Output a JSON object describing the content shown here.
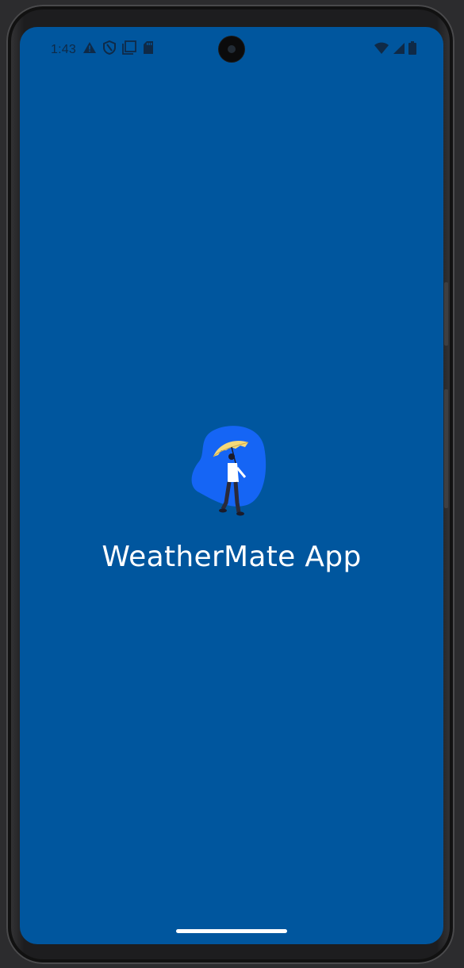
{
  "status_bar": {
    "time": "1:43",
    "left_icons": [
      "warning-icon",
      "shield-icon",
      "screen-mirror-icon",
      "sd-card-icon"
    ],
    "right_icons": [
      "wifi-icon",
      "cell-signal-icon",
      "battery-icon"
    ]
  },
  "splash": {
    "app_name": "WeatherMate App",
    "logo": "person-with-umbrella-illustration"
  },
  "colors": {
    "background": "#00569e",
    "logo_blob": "#1565f5",
    "umbrella": "#f5d97a",
    "text": "#ffffff"
  }
}
